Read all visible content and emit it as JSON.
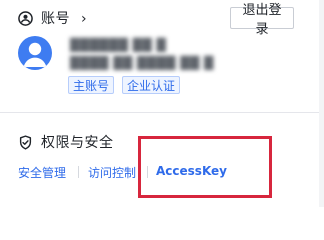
{
  "account": {
    "title": "账号",
    "chevron": "›",
    "logout_label": "退出登录",
    "username_blurred": "██████ ██ █",
    "account_id_blurred": "████ ██ ████ ██ █",
    "badges": [
      "主账号",
      "企业认证"
    ]
  },
  "security": {
    "title": "权限与安全",
    "links": {
      "security_management": "安全管理",
      "access_control": "访问控制",
      "access_key": "AccessKey"
    }
  },
  "colors": {
    "accent": "#2f6bea",
    "avatar": "#3e7cf1",
    "highlight": "#d7263d"
  },
  "icons": {
    "account": "user-circle-icon",
    "security": "shield-icon"
  }
}
